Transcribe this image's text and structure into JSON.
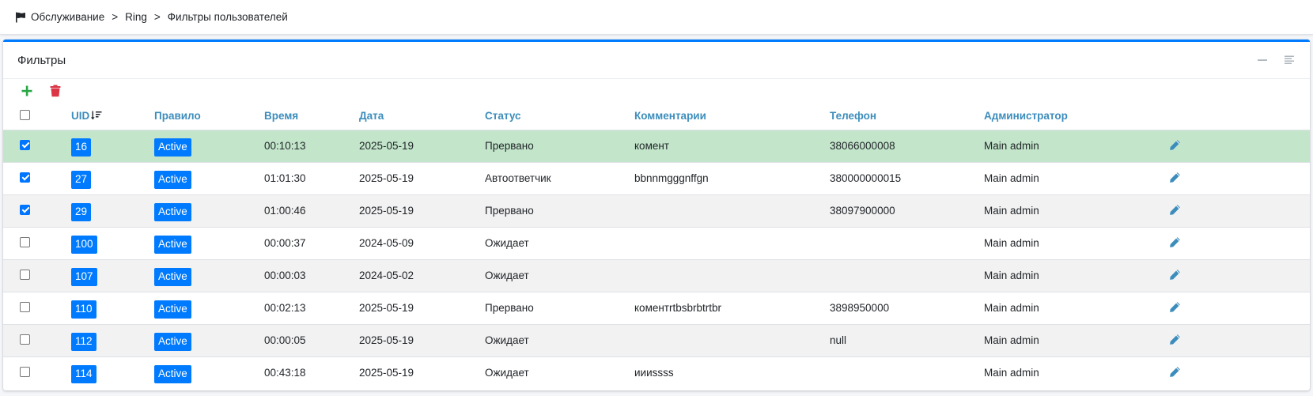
{
  "breadcrumb": {
    "items": [
      "Обслуживание",
      "Ring",
      "Фильтры пользователей"
    ],
    "separator": ">"
  },
  "card": {
    "title": "Фильтры",
    "accent_color": "#007bff"
  },
  "toolbar": {
    "add_icon": "plus-icon",
    "delete_icon": "trash-icon"
  },
  "table": {
    "columns": [
      "UID",
      "Правило",
      "Время",
      "Дата",
      "Статус",
      "Комментарии",
      "Телефон",
      "Администратор"
    ],
    "rows": [
      {
        "checked": true,
        "uid": "16",
        "rule": "Active",
        "time": "00:10:13",
        "date": "2025-05-19",
        "status": "Прервано",
        "comment": "комент",
        "phone": "38066000008",
        "admin": "Main admin"
      },
      {
        "checked": true,
        "uid": "27",
        "rule": "Active",
        "time": "01:01:30",
        "date": "2025-05-19",
        "status": "Автоответчик",
        "comment": "bbnnmgggnffgn",
        "phone": "380000000015",
        "admin": "Main admin"
      },
      {
        "checked": true,
        "uid": "29",
        "rule": "Active",
        "time": "01:00:46",
        "date": "2025-05-19",
        "status": "Прервано",
        "comment": "",
        "phone": "38097900000",
        "admin": "Main admin"
      },
      {
        "checked": false,
        "uid": "100",
        "rule": "Active",
        "time": "00:00:37",
        "date": "2024-05-09",
        "status": "Ожидает",
        "comment": "",
        "phone": "",
        "admin": "Main admin"
      },
      {
        "checked": false,
        "uid": "107",
        "rule": "Active",
        "time": "00:00:03",
        "date": "2024-05-02",
        "status": "Ожидает",
        "comment": "",
        "phone": "",
        "admin": "Main admin"
      },
      {
        "checked": false,
        "uid": "110",
        "rule": "Active",
        "time": "00:02:13",
        "date": "2025-05-19",
        "status": "Прервано",
        "comment": "коментrtbsbrbtrtbr",
        "phone": "3898950000",
        "admin": "Main admin"
      },
      {
        "checked": false,
        "uid": "112",
        "rule": "Active",
        "time": "00:00:05",
        "date": "2025-05-19",
        "status": "Ожидает",
        "comment": "",
        "phone": "null",
        "admin": "Main admin"
      },
      {
        "checked": false,
        "uid": "114",
        "rule": "Active",
        "time": "00:43:18",
        "date": "2025-05-19",
        "status": "Ожидает",
        "comment": "иииssss",
        "phone": "",
        "admin": "Main admin"
      }
    ]
  }
}
